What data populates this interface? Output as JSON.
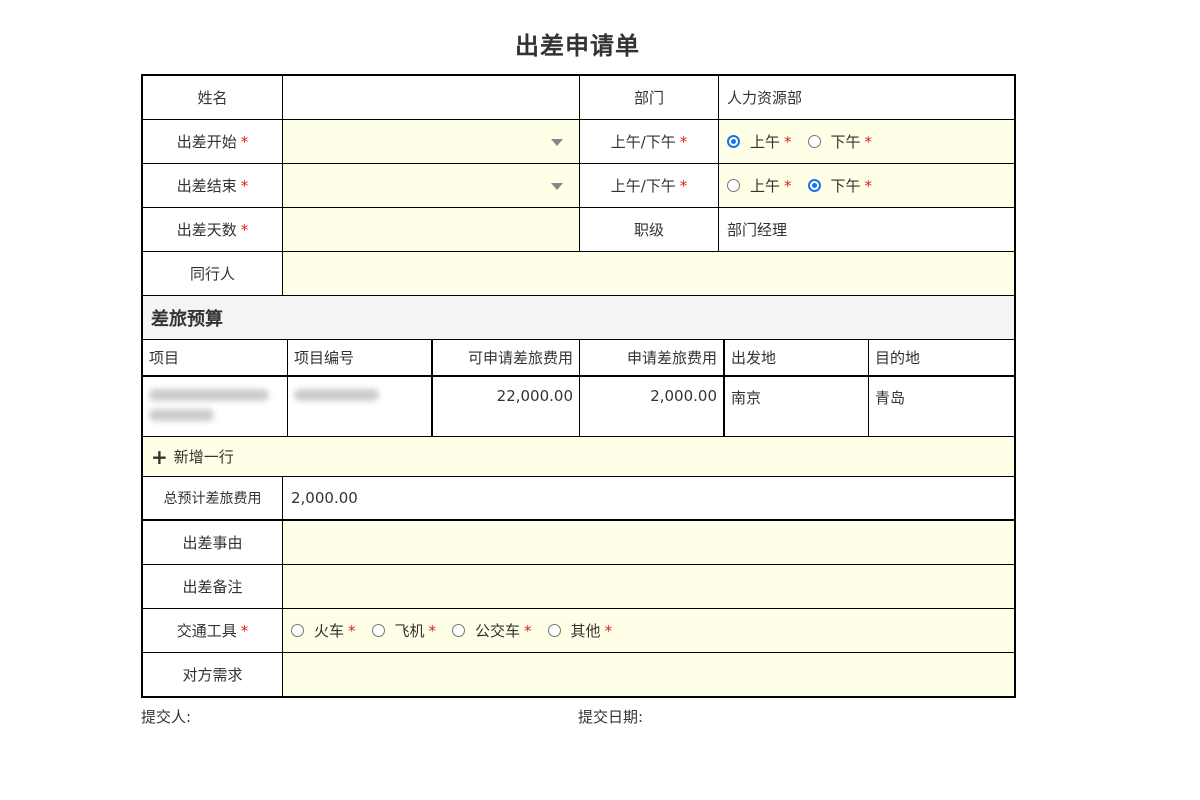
{
  "title": "出差申请单",
  "required_mark": "*",
  "fields": {
    "name_label": "姓名",
    "name_value": "",
    "dept_label": "部门",
    "dept_value": "人力资源部",
    "start_label": "出差开始",
    "start_value": "",
    "ampm_label": "上午/下午",
    "am_label": "上午",
    "pm_label": "下午",
    "start_ampm_selected": "上午",
    "end_label": "出差结束",
    "end_value": "",
    "end_ampm_selected": "下午",
    "days_label": "出差天数",
    "days_value": "",
    "level_label": "职级",
    "level_value": "部门经理",
    "companion_label": "同行人",
    "companion_value": ""
  },
  "budget": {
    "section_title": "差旅预算",
    "columns": [
      "项目",
      "项目编号",
      "可申请差旅费用",
      "申请差旅费用",
      "出发地",
      "目的地"
    ],
    "rows": [
      {
        "project": "",
        "project_code": "",
        "available": "22,000.00",
        "requested": "2,000.00",
        "origin": "南京",
        "destination": "青岛"
      }
    ],
    "add_row_label": "新增一行",
    "total_label": "总预计差旅费用",
    "total_value": "2,000.00"
  },
  "details": {
    "reason_label": "出差事由",
    "note_label": "出差备注",
    "transport_label": "交通工具",
    "transport_options": [
      "火车",
      "飞机",
      "公交车",
      "其他"
    ],
    "needs_label": "对方需求"
  },
  "footer": {
    "submitter_label": "提交人:",
    "submit_date_label": "提交日期:"
  },
  "colors": {
    "input_bg": "#fffee6",
    "required": "#e02020",
    "radio_selected": "#1a73e8"
  }
}
